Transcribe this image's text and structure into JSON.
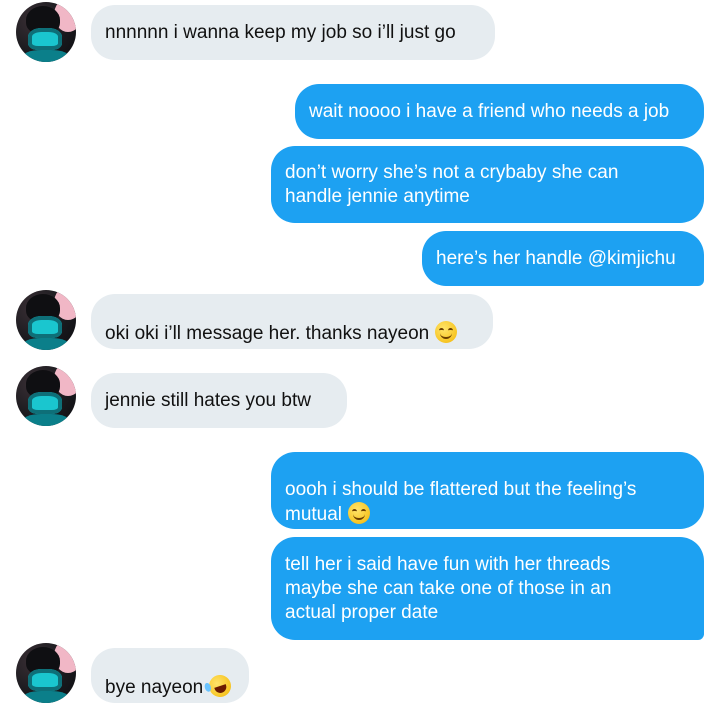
{
  "conversation": {
    "messages": [
      {
        "sender": "other",
        "text": "nnnnnn i wanna keep my job so i’ll just go"
      },
      {
        "sender": "me",
        "text": "wait noooo i have a friend who needs a job"
      },
      {
        "sender": "me",
        "text": "don’t worry she’s not a crybaby she can\nhandle jennie anytime"
      },
      {
        "sender": "me",
        "text": "here’s her handle @kimjichu"
      },
      {
        "sender": "other",
        "text": "oki oki i’ll message her. thanks nayeon",
        "emoji": "smiling-face-icon"
      },
      {
        "sender": "other",
        "text": "jennie still hates you btw"
      },
      {
        "sender": "me",
        "text": "oooh i should be flattered but the feeling’s\nmutual",
        "emoji": "smiling-face-icon"
      },
      {
        "sender": "me",
        "text": "tell her i said have fun with her threads\nmaybe she can take one of those in an\nactual proper date"
      },
      {
        "sender": "other",
        "text": "bye nayeon",
        "emoji": "rolling-laughing-face-icon"
      }
    ]
  },
  "colors": {
    "sent_bubble": "#1da1f2",
    "received_bubble": "#e6ecf0",
    "sent_text": "#ffffff",
    "received_text": "#111111"
  }
}
